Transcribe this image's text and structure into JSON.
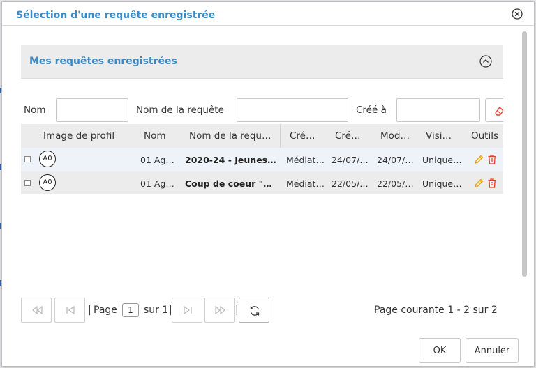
{
  "dialog": {
    "title": "Sélection d'une requête enregistrée",
    "close_icon": "close-circle-icon"
  },
  "section": {
    "title": "Mes requêtes enregistrées",
    "collapse_icon": "chevron-up-circle-icon"
  },
  "filters": {
    "nom_label": "Nom",
    "nom_value": "",
    "query_label": "Nom de la requête",
    "query_value": "",
    "created_label": "Créé à",
    "created_value": "",
    "clear_icon": "eraser-icon"
  },
  "table": {
    "columns": [
      "Image de profil",
      "Nom",
      "Nom de la requ…",
      "Cré…",
      "Cré…",
      "Mod…",
      "Visi…",
      "Outils"
    ],
    "rows": [
      {
        "avatar": "A0",
        "nom": "01 Age…",
        "requete": "2020-24 - Jeunes …",
        "cree_par": "Médiat…",
        "cree_le": "24/07/…",
        "modifie": "24/07/…",
        "visibilite": "Unique…"
      },
      {
        "avatar": "A0",
        "nom": "01 Age…",
        "requete": "Coup de coeur \"Br…",
        "cree_par": "Médiat…",
        "cree_le": "22/05/…",
        "modifie": "22/05/…",
        "visibilite": "Unique…"
      }
    ]
  },
  "pager": {
    "page_label": "Page",
    "current_page": "1",
    "of_label": "sur 1",
    "separator": "|",
    "status": "Page courante 1 - 2 sur 2"
  },
  "footer": {
    "ok_label": "OK",
    "cancel_label": "Annuler"
  },
  "colors": {
    "accent": "#3a8ac5",
    "edit_icon": "#f0a500",
    "delete_icon": "#e0442c"
  }
}
